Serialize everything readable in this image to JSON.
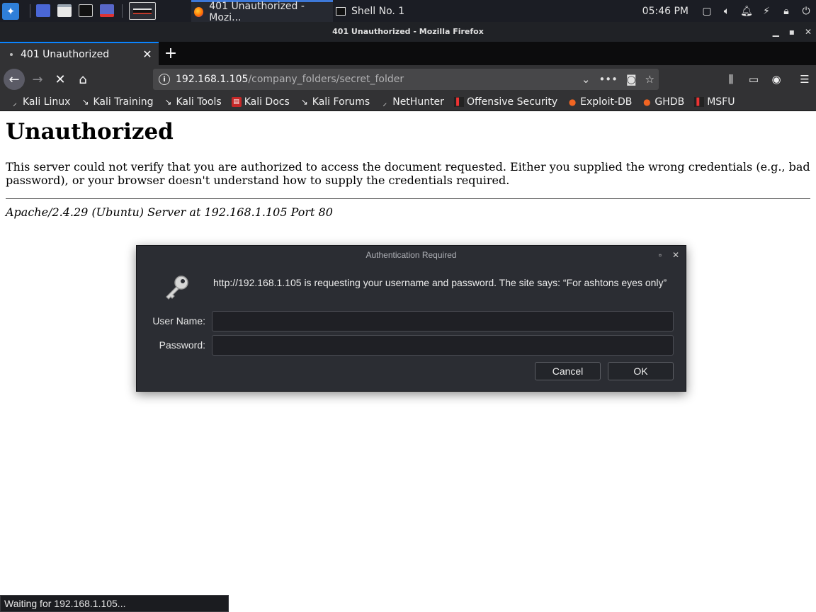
{
  "taskbar": {
    "tasks": [
      {
        "label": "401 Unauthorized - Mozi...",
        "icon": "firefox-icon",
        "active": true
      },
      {
        "label": "Shell No. 1",
        "icon": "terminal-icon",
        "active": false
      }
    ],
    "clock": "05:46 PM"
  },
  "window": {
    "title": "401 Unauthorized - Mozilla Firefox"
  },
  "browser": {
    "tab_label": "401 Unauthorized",
    "url_host": "192.168.1.105",
    "url_path": "/company_folders/secret_folder",
    "bookmarks": [
      {
        "label": "Kali Linux",
        "icon": "kali-dragon-icon"
      },
      {
        "label": "Kali Training",
        "icon": "kali-dragon-icon"
      },
      {
        "label": "Kali Tools",
        "icon": "kali-dragon-icon"
      },
      {
        "label": "Kali Docs",
        "icon": "kali-docs-icon"
      },
      {
        "label": "Kali Forums",
        "icon": "kali-dragon-icon"
      },
      {
        "label": "NetHunter",
        "icon": "nethunter-icon"
      },
      {
        "label": "Offensive Security",
        "icon": "offsec-icon"
      },
      {
        "label": "Exploit-DB",
        "icon": "exploitdb-icon"
      },
      {
        "label": "GHDB",
        "icon": "exploitdb-icon"
      },
      {
        "label": "MSFU",
        "icon": "offsec-icon"
      }
    ],
    "status": "Waiting for 192.168.1.105..."
  },
  "page": {
    "heading": "Unauthorized",
    "body": "This server could not verify that you are authorized to access the document requested. Either you supplied the wrong credentials (e.g., bad password), or your browser doesn't understand how to supply the credentials required.",
    "signature": "Apache/2.4.29 (Ubuntu) Server at 192.168.1.105 Port 80"
  },
  "dialog": {
    "title": "Authentication Required",
    "message": "http://192.168.1.105 is requesting your username and password. The site says: “For ashtons eyes only”",
    "username_label": "User Name:",
    "username_value": "",
    "password_label": "Password:",
    "password_value": "",
    "cancel_label": "Cancel",
    "ok_label": "OK"
  }
}
